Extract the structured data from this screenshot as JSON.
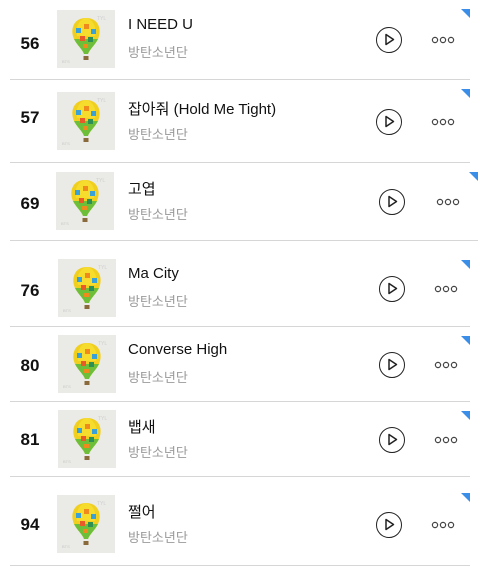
{
  "artist_name": "방탄소년단",
  "accent_color": "#3b8ee8",
  "tracks": [
    {
      "rank": "56",
      "title": "I NEED U"
    },
    {
      "rank": "57",
      "title": "잡아줘 (Hold Me Tight)"
    },
    {
      "rank": "69",
      "title": "고엽"
    },
    {
      "rank": "76",
      "title": "Ma City"
    },
    {
      "rank": "80",
      "title": "Converse High"
    },
    {
      "rank": "81",
      "title": "뱁새"
    },
    {
      "rank": "94",
      "title": "쩔어"
    }
  ],
  "icons": {
    "play": "play-icon",
    "more": "more-options-icon",
    "cover": "album-cover-hot-air-balloon"
  }
}
